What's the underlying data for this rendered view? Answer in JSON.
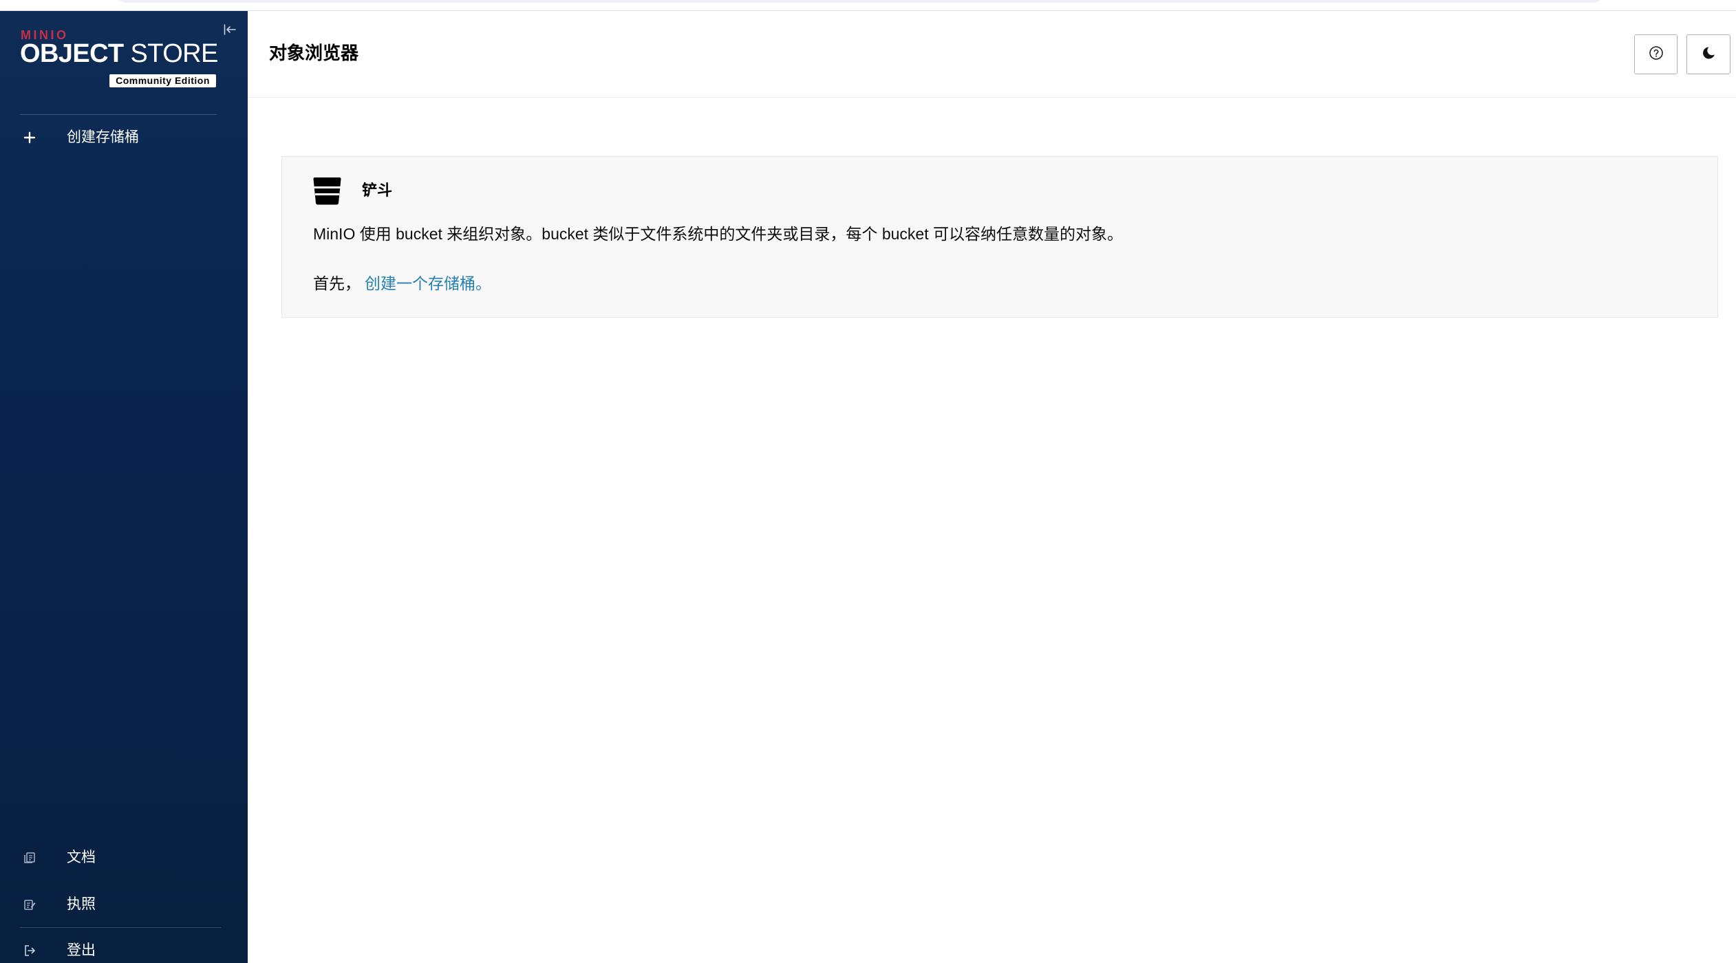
{
  "sidebar": {
    "logo": {
      "brand": "MINIO",
      "product_bold": "OBJECT",
      "product_light": "STORE",
      "edition": "Community Edition"
    },
    "collapse_icon": "collapse-sidebar-icon",
    "create_bucket": {
      "label": "创建存储桶",
      "icon": "plus-icon"
    },
    "footer_items": [
      {
        "label": "文档",
        "icon": "documentation-icon"
      },
      {
        "label": "执照",
        "icon": "license-icon"
      },
      {
        "label": "登出",
        "icon": "logout-icon"
      }
    ]
  },
  "header": {
    "title": "对象浏览器",
    "help_icon": "help-circle-icon",
    "theme_icon": "moon-icon"
  },
  "main": {
    "empty_state": {
      "icon": "bucket-icon",
      "title": "铲斗",
      "description": "MinIO 使用 bucket 来组织对象。bucket 类似于文件系统中的文件夹或目录，每个 bucket 可以容纳任意数量的对象。",
      "prompt": "首先，",
      "link": "创建一个存储桶。"
    }
  },
  "colors": {
    "sidebar_background": "#0A2550",
    "brand_red": "#C72E49",
    "link": "#2781B0"
  }
}
